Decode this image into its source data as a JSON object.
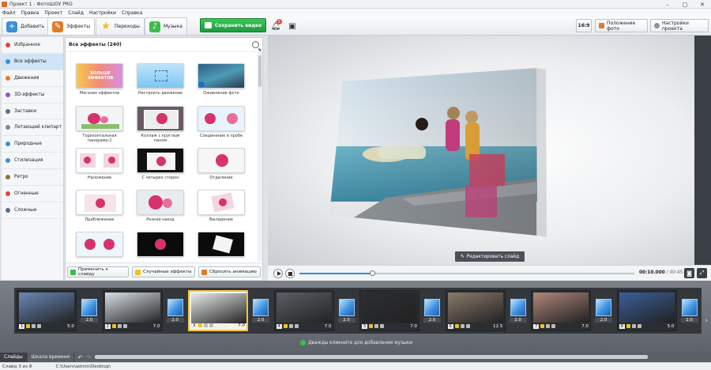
{
  "window": {
    "title": "Проект 1 - ФотоШОУ PRO"
  },
  "menu": [
    "Файл",
    "Правка",
    "Проект",
    "Слайд",
    "Настройки",
    "Справка"
  ],
  "toolbar": {
    "tabs": [
      {
        "label": "Добавить",
        "icon": "add-photo-icon",
        "color": "#3a8fd9"
      },
      {
        "label": "Эффекты",
        "icon": "effects-icon",
        "color": "#e07b2a"
      },
      {
        "label": "Переходы",
        "icon": "star-icon",
        "color": "#f1c21b"
      },
      {
        "label": "Музыка",
        "icon": "music-icon",
        "color": "#3fbd4b"
      }
    ],
    "save_label": "Сохранить видео",
    "badge": "5",
    "ratio": "16:9",
    "photo_position": "Положение фото",
    "project_settings": "Настройки проекта"
  },
  "categories": [
    {
      "label": "Избранное",
      "color": "#e3443c"
    },
    {
      "label": "Все эффекты",
      "color": "#3a8fd9"
    },
    {
      "label": "Движения",
      "color": "#e07b2a"
    },
    {
      "label": "3D-эффекты",
      "color": "#9a4fd1"
    },
    {
      "label": "Заставки",
      "color": "#5a6f86"
    },
    {
      "label": "Летающий клипарт",
      "color": "#888888"
    },
    {
      "label": "Природные",
      "color": "#3a8fd9"
    },
    {
      "label": "Стилизация",
      "color": "#3a8fd9"
    },
    {
      "label": "Ретро",
      "color": "#9a6a3a"
    },
    {
      "label": "Огненные",
      "color": "#e3443c"
    },
    {
      "label": "Сложные",
      "color": "#5a6f86"
    }
  ],
  "effects": {
    "header": "Все эффекты (240)",
    "items": [
      {
        "label": "Магазин эффектов",
        "thumb_text": "БОЛЬШЕ ЭФФЕКТОВ"
      },
      {
        "label": "Настроить движение"
      },
      {
        "label": "Оживление фото"
      },
      {
        "label": "Горизонтальная панорама-2"
      },
      {
        "label": "Коллаж с круглым паном"
      },
      {
        "label": "Соединение в пробе"
      },
      {
        "label": "Наложение"
      },
      {
        "label": "С четырех сторон"
      },
      {
        "label": "Отдаление"
      },
      {
        "label": "Приближение"
      },
      {
        "label": "Резкий наезд"
      },
      {
        "label": "Выпадение"
      },
      {
        "label": ""
      },
      {
        "label": ""
      },
      {
        "label": ""
      }
    ],
    "buttons": {
      "apply": "Применить к слайду",
      "random": "Случайные эффекты",
      "reset": "Сбросить анимацию"
    }
  },
  "preview": {
    "edit_slide": "Редактировать слайд",
    "time_current": "00:10.000",
    "time_total": "/ 00:45.500",
    "progress": 0.22
  },
  "timeline": {
    "slides": [
      {
        "num": "1",
        "dur": "5.0",
        "bg": "#6a88b8"
      },
      {
        "num": "2",
        "dur": "7.0",
        "bg": "#d8dfe6"
      },
      {
        "num": "3",
        "dur": "7.0",
        "bg": "#e9ece9",
        "selected": true
      },
      {
        "num": "4",
        "dur": "7.0",
        "bg": "#5b5f64"
      },
      {
        "num": "5",
        "dur": "7.0",
        "bg": "#2c2e31"
      },
      {
        "num": "6",
        "dur": "12.5",
        "bg": "#8a7a6a"
      },
      {
        "num": "7",
        "dur": "7.0",
        "bg": "#b0877a"
      },
      {
        "num": "8",
        "dur": "5.0",
        "bg": "#3a5f9a"
      }
    ],
    "transitions": [
      "2.0",
      "2.0",
      "2.0",
      "2.0",
      "2.0",
      "2.0",
      "2.0",
      "2.0"
    ],
    "add_music": "Дважды кликните для добавления музыки"
  },
  "bottom_tabs": [
    "Слайды",
    "Шкала времени"
  ],
  "status": {
    "slide": "Слайд 3 из 8",
    "path": "C:\\Users\\admin\\Desktop\\"
  }
}
